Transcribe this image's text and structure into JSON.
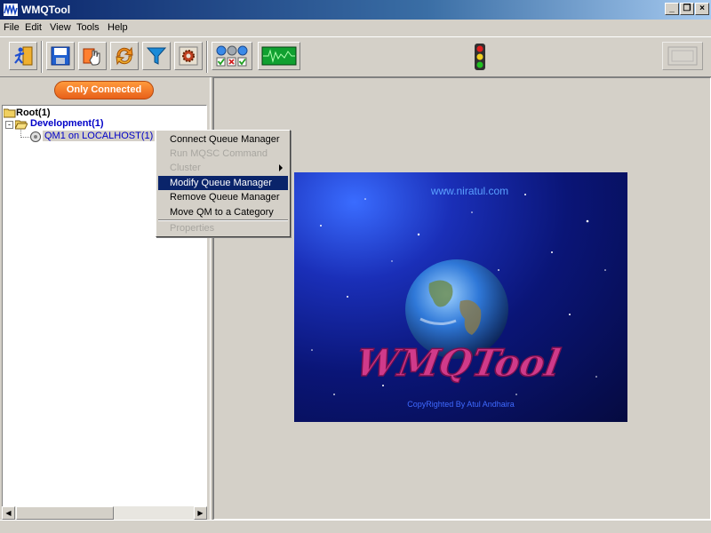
{
  "window": {
    "title": "WMQTool"
  },
  "menubar": {
    "items": [
      "File",
      "Edit",
      "View",
      "Tools",
      "Help"
    ]
  },
  "toolbar": {
    "buttons": [
      "exit-icon",
      "save-icon",
      "hand-icon",
      "refresh-icon",
      "filter-icon",
      "settings-icon",
      "status-lights-icon",
      "monitor-icon"
    ],
    "status_indicator": "traffic-light-icon"
  },
  "leftpanel": {
    "filter_button": "Only Connected",
    "tree": {
      "root": "Root(1)",
      "category": "Development(1)",
      "qm": "QM1 on LOCALHOST(1)"
    }
  },
  "context_menu": {
    "items": [
      {
        "label": "Connect Queue Manager",
        "enabled": true
      },
      {
        "label": "Run MQSC Command",
        "enabled": false
      },
      {
        "label": "Cluster",
        "enabled": false,
        "submenu": true
      },
      {
        "label": "Modify Queue Manager",
        "enabled": true,
        "selected": true
      },
      {
        "label": "Remove Queue Manager",
        "enabled": true
      },
      {
        "label": "Move QM to a Category",
        "enabled": true
      },
      {
        "label": "Properties",
        "enabled": false
      }
    ]
  },
  "splash": {
    "url": "www.niratul.com",
    "logo_text": "WMQTool",
    "copyright": "CopyRighted By Atul Andhaira"
  }
}
